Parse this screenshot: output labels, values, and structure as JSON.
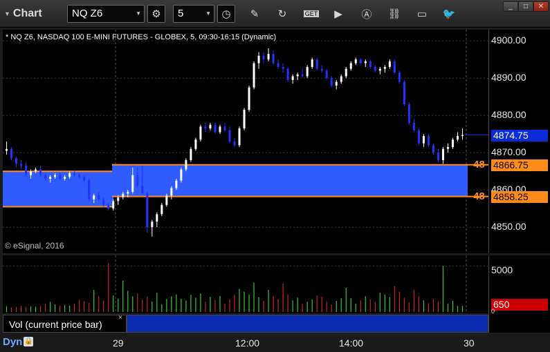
{
  "toolbar": {
    "title": "Chart",
    "symbol": "NQ Z6",
    "interval": "5"
  },
  "window": {
    "minimize": "_",
    "restore": "□",
    "close": "✕"
  },
  "chart": {
    "description": "* NQ Z6, NASDAQ 100 E-MINI FUTURES - GLOBEX, 5, 09:30-16:15 (Dynamic)",
    "copyright": "© eSignal, 2016",
    "last_price": "4874.75",
    "level_upper": {
      "label": "48",
      "price": "4866.75",
      "color": "#ff8c1a"
    },
    "level_lower": {
      "label": "48",
      "price": "4858.25",
      "color": "#ff8c1a"
    },
    "band_color": "#2f5bff",
    "up_color": "#ffffff",
    "down_color": "#2233ff"
  },
  "volume": {
    "title": "Vol (current price bar)",
    "close_label": "×",
    "current": "650",
    "axis_top": "5000",
    "axis_bottom": "0"
  },
  "footer": {
    "mode": "Dyn"
  },
  "chart_data": {
    "type": "candlestick",
    "y_ticks": [
      "4900.00",
      "4890.00",
      "4880.00",
      "4870.00",
      "4860.00",
      "4850.00"
    ],
    "ylim": [
      4843,
      4903
    ],
    "x_ticks": [
      "29",
      "12:00",
      "14:00",
      "30"
    ],
    "bars": [
      [
        4870.5,
        4873.0,
        4869.5,
        4871.0
      ],
      [
        4871.0,
        4871.5,
        4868.0,
        4868.5
      ],
      [
        4868.5,
        4869.0,
        4866.0,
        4867.0
      ],
      [
        4867.0,
        4868.0,
        4865.5,
        4866.5
      ],
      [
        4866.5,
        4867.5,
        4863.5,
        4864.0
      ],
      [
        4864.0,
        4865.5,
        4863.0,
        4865.0
      ],
      [
        4865.0,
        4866.0,
        4864.5,
        4865.5
      ],
      [
        4865.5,
        4866.5,
        4863.5,
        4864.0
      ],
      [
        4864.0,
        4864.5,
        4862.5,
        4863.0
      ],
      [
        4863.0,
        4864.0,
        4862.0,
        4863.5
      ],
      [
        4863.5,
        4864.5,
        4863.0,
        4864.0
      ],
      [
        4864.0,
        4864.5,
        4862.5,
        4863.0
      ],
      [
        4863.0,
        4864.0,
        4862.5,
        4863.5
      ],
      [
        4863.5,
        4865.0,
        4863.0,
        4864.5
      ],
      [
        4864.5,
        4865.5,
        4863.5,
        4864.0
      ],
      [
        4864.0,
        4864.5,
        4863.0,
        4863.5
      ],
      [
        4863.5,
        4864.0,
        4862.0,
        4862.5
      ],
      [
        4862.5,
        4863.0,
        4857.0,
        4857.5
      ],
      [
        4857.5,
        4859.0,
        4856.5,
        4858.5
      ],
      [
        4858.5,
        4859.5,
        4857.0,
        4857.5
      ],
      [
        4857.5,
        4858.0,
        4855.5,
        4856.0
      ],
      [
        4856.0,
        4856.5,
        4854.5,
        4855.0
      ],
      [
        4855.0,
        4857.5,
        4854.5,
        4857.0
      ],
      [
        4857.0,
        4858.5,
        4856.0,
        4858.0
      ],
      [
        4858.0,
        4859.5,
        4857.5,
        4859.0
      ],
      [
        4859.0,
        4860.0,
        4858.0,
        4859.5
      ],
      [
        4859.5,
        4866.0,
        4859.0,
        4864.0
      ],
      [
        4864.0,
        4866.0,
        4860.5,
        4861.0
      ],
      [
        4861.0,
        4866.5,
        4859.5,
        4859.0
      ],
      [
        4859.0,
        4859.5,
        4848.5,
        4850.0
      ],
      [
        4850.0,
        4852.0,
        4847.5,
        4851.5
      ],
      [
        4851.5,
        4854.0,
        4850.0,
        4853.5
      ],
      [
        4853.5,
        4856.5,
        4853.0,
        4856.0
      ],
      [
        4856.0,
        4859.0,
        4855.5,
        4858.5
      ],
      [
        4858.5,
        4861.0,
        4857.5,
        4860.5
      ],
      [
        4860.5,
        4863.0,
        4860.0,
        4862.5
      ],
      [
        4862.5,
        4866.0,
        4862.0,
        4865.5
      ],
      [
        4865.5,
        4868.5,
        4865.0,
        4868.0
      ],
      [
        4868.0,
        4871.5,
        4867.5,
        4871.0
      ],
      [
        4871.0,
        4874.0,
        4870.5,
        4873.5
      ],
      [
        4873.5,
        4877.5,
        4873.0,
        4877.0
      ],
      [
        4877.0,
        4878.0,
        4875.5,
        4876.5
      ],
      [
        4876.5,
        4878.0,
        4876.0,
        4877.5
      ],
      [
        4877.5,
        4878.0,
        4875.0,
        4875.5
      ],
      [
        4875.5,
        4877.5,
        4875.0,
        4877.0
      ],
      [
        4877.0,
        4878.0,
        4875.5,
        4876.0
      ],
      [
        4876.0,
        4877.0,
        4872.5,
        4873.0
      ],
      [
        4873.0,
        4874.0,
        4871.5,
        4872.0
      ],
      [
        4872.0,
        4877.0,
        4871.5,
        4876.5
      ],
      [
        4876.5,
        4882.0,
        4876.0,
        4881.5
      ],
      [
        4881.5,
        4888.0,
        4881.0,
        4887.5
      ],
      [
        4887.5,
        4894.5,
        4887.0,
        4894.0
      ],
      [
        4894.0,
        4897.0,
        4892.5,
        4896.0
      ],
      [
        4896.0,
        4897.0,
        4894.0,
        4895.0
      ],
      [
        4895.0,
        4898.0,
        4894.5,
        4896.5
      ],
      [
        4896.5,
        4897.5,
        4893.5,
        4894.0
      ],
      [
        4894.0,
        4895.0,
        4892.5,
        4893.0
      ],
      [
        4893.0,
        4894.0,
        4891.5,
        4892.5
      ],
      [
        4892.5,
        4893.0,
        4889.0,
        4889.5
      ],
      [
        4889.5,
        4891.0,
        4888.5,
        4890.5
      ],
      [
        4890.5,
        4891.5,
        4889.5,
        4891.0
      ],
      [
        4891.0,
        4892.5,
        4890.0,
        4890.5
      ],
      [
        4890.5,
        4893.5,
        4890.0,
        4893.0
      ],
      [
        4893.0,
        4895.5,
        4892.5,
        4895.0
      ],
      [
        4895.0,
        4895.5,
        4892.0,
        4892.5
      ],
      [
        4892.5,
        4893.5,
        4891.5,
        4892.0
      ],
      [
        4892.0,
        4892.5,
        4889.5,
        4890.0
      ],
      [
        4890.0,
        4890.5,
        4887.5,
        4888.0
      ],
      [
        4888.0,
        4889.5,
        4887.0,
        4889.0
      ],
      [
        4889.0,
        4891.0,
        4888.5,
        4890.5
      ],
      [
        4890.5,
        4893.0,
        4890.0,
        4892.5
      ],
      [
        4892.5,
        4894.5,
        4892.0,
        4894.0
      ],
      [
        4894.0,
        4895.5,
        4893.5,
        4895.0
      ],
      [
        4895.0,
        4895.5,
        4893.5,
        4894.0
      ],
      [
        4894.0,
        4895.0,
        4893.0,
        4894.5
      ],
      [
        4894.5,
        4895.0,
        4892.5,
        4893.0
      ],
      [
        4893.0,
        4893.5,
        4891.5,
        4892.0
      ],
      [
        4892.0,
        4893.0,
        4891.0,
        4892.5
      ],
      [
        4892.5,
        4893.5,
        4891.5,
        4893.0
      ],
      [
        4893.0,
        4895.0,
        4892.5,
        4894.5
      ],
      [
        4894.5,
        4895.0,
        4891.0,
        4891.5
      ],
      [
        4891.5,
        4892.0,
        4888.5,
        4889.0
      ],
      [
        4889.0,
        4889.5,
        4882.5,
        4883.0
      ],
      [
        4883.0,
        4883.5,
        4877.5,
        4878.0
      ],
      [
        4878.0,
        4879.0,
        4875.5,
        4876.0
      ],
      [
        4876.0,
        4876.5,
        4872.0,
        4872.5
      ],
      [
        4872.5,
        4875.0,
        4871.5,
        4874.5
      ],
      [
        4874.5,
        4875.0,
        4871.5,
        4872.0
      ],
      [
        4872.0,
        4872.5,
        4869.5,
        4870.0
      ],
      [
        4870.0,
        4871.0,
        4867.5,
        4868.0
      ],
      [
        4868.0,
        4871.5,
        4867.0,
        4871.0
      ],
      [
        4871.0,
        4872.5,
        4870.0,
        4871.5
      ],
      [
        4871.5,
        4874.0,
        4871.0,
        4873.5
      ],
      [
        4873.5,
        4875.5,
        4873.0,
        4874.5
      ],
      [
        4874.5,
        4876.5,
        4873.5,
        4874.75
      ]
    ],
    "volume": [
      620,
      480,
      550,
      700,
      520,
      610,
      580,
      650,
      900,
      1100,
      820,
      700,
      760,
      680,
      900,
      1300,
      1150,
      980,
      2400,
      1700,
      1250,
      5300,
      1800,
      1450,
      3400,
      2300,
      1700,
      2000,
      1300,
      1650,
      1150,
      2100,
      850,
      1400,
      1700,
      1900,
      1450,
      1250,
      1850,
      1550,
      2000,
      1100,
      1650,
      1300,
      1750,
      900,
      1350,
      1850,
      2500,
      2200,
      1900,
      3200,
      1600,
      1200,
      2400,
      1750,
      1400,
      3100,
      1900,
      1250,
      1550,
      900,
      1100,
      1350,
      1800,
      1650,
      1150,
      800,
      1200,
      1500,
      2600,
      1500,
      900,
      1250,
      1700,
      1350,
      1100,
      2100,
      1900,
      1600,
      2800,
      2200,
      1550,
      1050,
      2400,
      1700,
      1250,
      950,
      1400,
      1100,
      5000,
      900,
      1200,
      650,
      650
    ],
    "volume_ylim": [
      0,
      6000
    ]
  }
}
